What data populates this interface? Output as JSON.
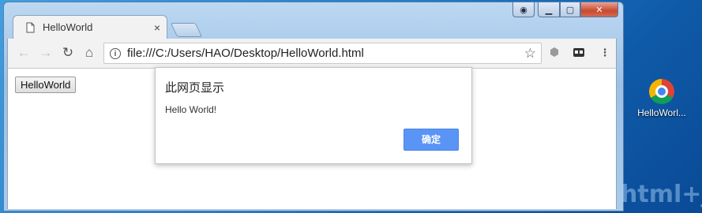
{
  "window": {
    "controls": {
      "min": "▁",
      "max": "▢",
      "close": "✕"
    }
  },
  "tab": {
    "title": "HelloWorld",
    "close": "×"
  },
  "toolbar": {
    "url": "file:///C:/Users/HAO/Desktop/HelloWorld.html",
    "icons": [
      "back-icon",
      "forward-icon",
      "reload-icon",
      "home-icon",
      "info-icon",
      "star-icon",
      "extension-icon",
      "cast-icon",
      "menu-icon"
    ]
  },
  "page": {
    "button_label": "HelloWorld"
  },
  "dialog": {
    "title": "此网页显示",
    "message": "Hello World!",
    "ok_label": "确定"
  },
  "desktop": {
    "icon_label": "HelloWorl...",
    "watermark": "html+js"
  },
  "colors": {
    "accent": "#5a95f5",
    "desktop": "#1f7dcc"
  }
}
